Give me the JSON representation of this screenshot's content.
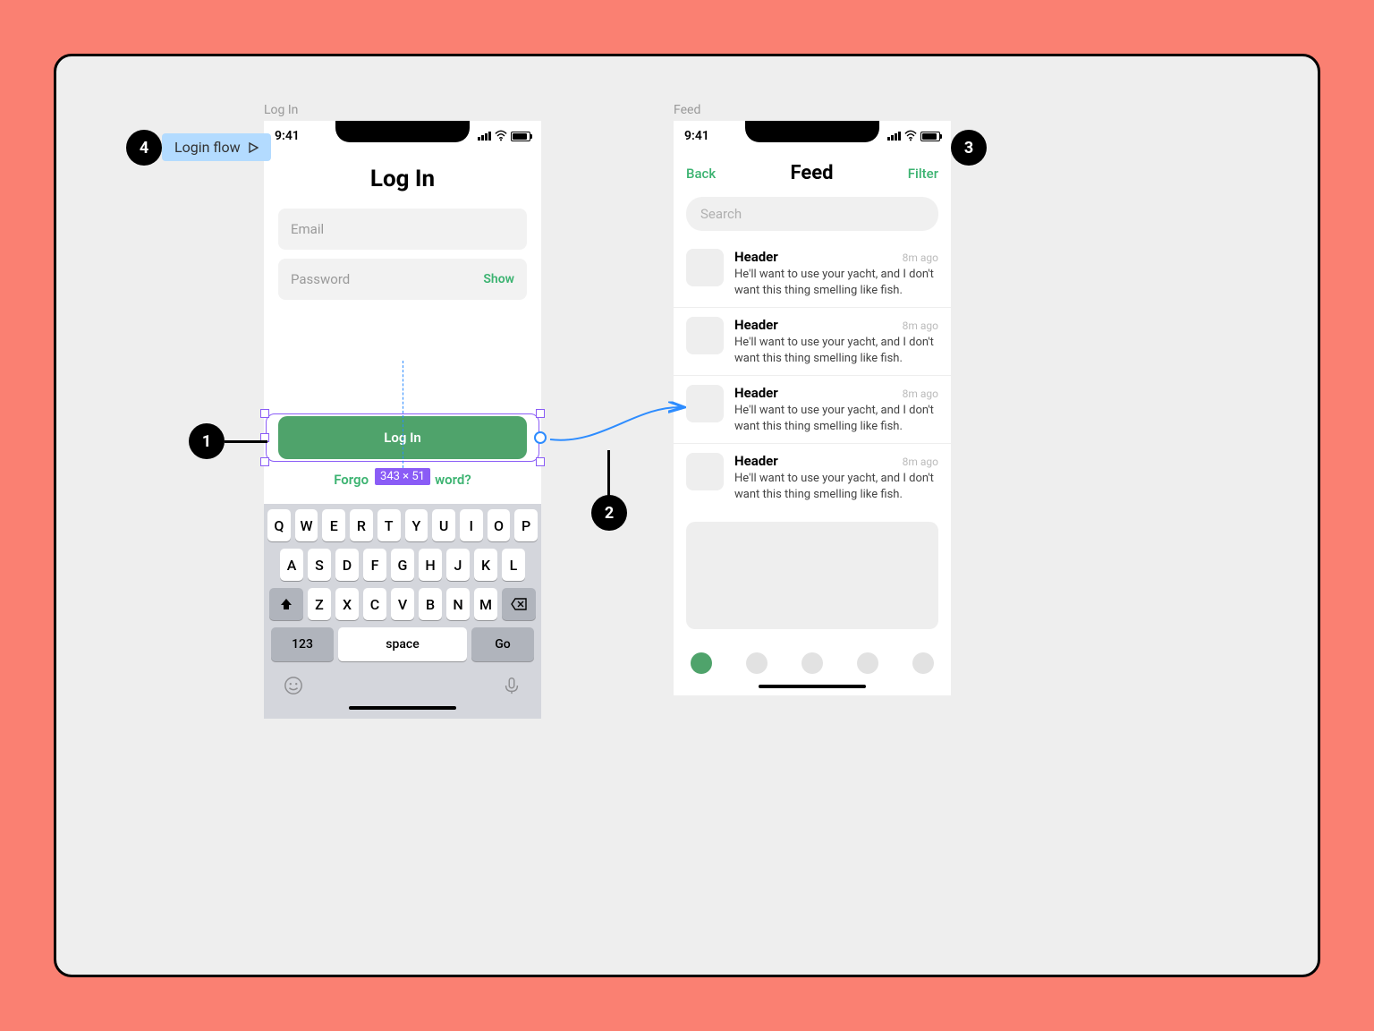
{
  "flow_label": "Login flow",
  "badges": {
    "b1": "1",
    "b2": "2",
    "b3": "3",
    "b4": "4"
  },
  "frames": {
    "login": {
      "label": "Log In",
      "status_time": "9:41",
      "title": "Log In",
      "email_placeholder": "Email",
      "password_placeholder": "Password",
      "show_label": "Show",
      "login_button": "Log In",
      "dimensions_badge": "343 × 51",
      "forgot_prefix": "Forgo",
      "forgot_suffix": "word?",
      "keyboard": {
        "row1": [
          "Q",
          "W",
          "E",
          "R",
          "T",
          "Y",
          "U",
          "I",
          "O",
          "P"
        ],
        "row2": [
          "A",
          "S",
          "D",
          "F",
          "G",
          "H",
          "J",
          "K",
          "L"
        ],
        "row3": [
          "Z",
          "X",
          "C",
          "V",
          "B",
          "N",
          "M"
        ],
        "k123": "123",
        "space": "space",
        "go": "Go"
      }
    },
    "feed": {
      "label": "Feed",
      "status_time": "9:41",
      "back": "Back",
      "title": "Feed",
      "filter": "Filter",
      "search_placeholder": "Search",
      "items": [
        {
          "header": "Header",
          "time": "8m ago",
          "text": "He'll want to use your yacht, and I don't want this thing smelling like fish."
        },
        {
          "header": "Header",
          "time": "8m ago",
          "text": "He'll want to use your yacht, and I don't want this thing smelling like fish."
        },
        {
          "header": "Header",
          "time": "8m ago",
          "text": "He'll want to use your yacht, and I don't want this thing smelling like fish."
        },
        {
          "header": "Header",
          "time": "8m ago",
          "text": "He'll want to use your yacht, and I don't want this thing smelling like fish."
        }
      ]
    }
  }
}
